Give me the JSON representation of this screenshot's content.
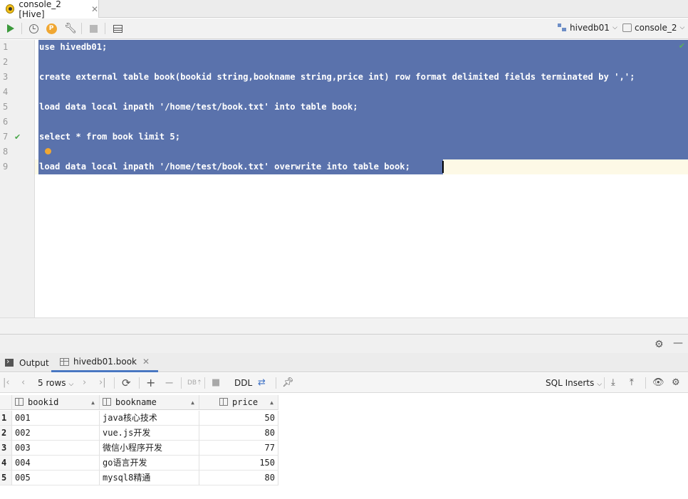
{
  "tab": {
    "label": "console_2 [Hive]",
    "close": "✕"
  },
  "toolbar": {
    "pbadge": "P",
    "datasource": "hivedb01",
    "console": "console_2"
  },
  "editor": {
    "lines": [
      {
        "num": "1",
        "code": "use hivedb01;"
      },
      {
        "num": "2",
        "code": ""
      },
      {
        "num": "3",
        "code": "create external table book(bookid string,bookname string,price int) row format delimited fields terminated by ',';"
      },
      {
        "num": "4",
        "code": ""
      },
      {
        "num": "5",
        "code": "load data local inpath '/home/test/book.txt' into table book;"
      },
      {
        "num": "6",
        "code": ""
      },
      {
        "num": "7",
        "code": "select * from book limit 5;"
      },
      {
        "num": "8",
        "code": ""
      },
      {
        "num": "9",
        "code": "load data local inpath '/home/test/book.txt' overwrite into table book;"
      }
    ]
  },
  "result_tabs": {
    "output": "Output",
    "table": "hivedb01.book",
    "close": "✕"
  },
  "result_toolbar": {
    "rows": "5 rows",
    "ddl": "DDL",
    "format": "SQL Inserts"
  },
  "grid": {
    "columns": [
      "bookid",
      "bookname",
      "price"
    ],
    "rows": [
      {
        "n": "1",
        "bookid": "001",
        "bookname": "java核心技术",
        "price": "50"
      },
      {
        "n": "2",
        "bookid": "002",
        "bookname": "vue.js开发",
        "price": "80"
      },
      {
        "n": "3",
        "bookid": "003",
        "bookname": "微信小程序开发",
        "price": "77"
      },
      {
        "n": "4",
        "bookid": "004",
        "bookname": "go语言开发",
        "price": "150"
      },
      {
        "n": "5",
        "bookid": "005",
        "bookname": "mysql8精通",
        "price": "80"
      }
    ]
  }
}
